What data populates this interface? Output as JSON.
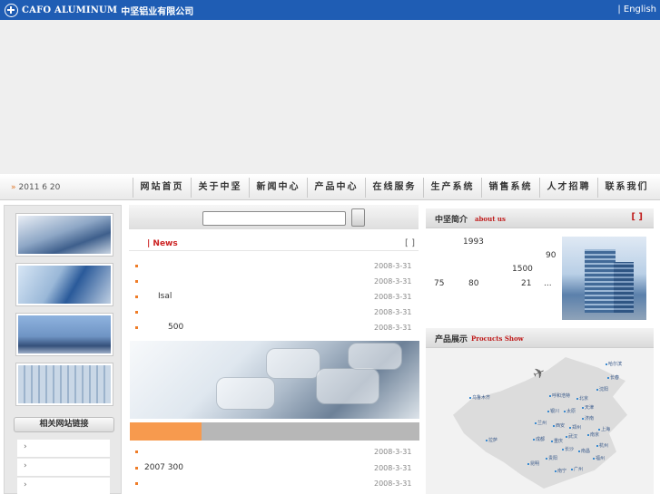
{
  "header": {
    "brand_en": "CAFO ALUMINUM",
    "brand_cn": "中坚铝业有限公司",
    "lang_link": "| English"
  },
  "navbar": {
    "date": "2011 6 20",
    "items": [
      "网站首页",
      "关于中坚",
      "新闻中心",
      "产品中心",
      "在线服务",
      "生产系统",
      "销售系统",
      "人才招聘",
      "联系我们"
    ]
  },
  "left": {
    "thumbs": [
      "building-photo-icon",
      "building-photo-icon",
      "building-photo-icon",
      "building-photo-icon"
    ],
    "links_title": "相关网站链接",
    "links": [
      "›",
      "›",
      "›"
    ]
  },
  "news": {
    "title": "| News",
    "more": "[ ]",
    "items": [
      {
        "text": "",
        "date": "2008-3-31"
      },
      {
        "text": "",
        "date": "2008-3-31"
      },
      {
        "text": "Isal",
        "date": "2008-3-31"
      },
      {
        "text": "",
        "date": "2008-3-31"
      },
      {
        "text": "500",
        "date": "2008-3-31"
      }
    ],
    "lower_items": [
      {
        "text": "",
        "date": "2008-3-31"
      },
      {
        "text": "2007       300",
        "date": "2008-3-31"
      },
      {
        "text": "",
        "date": "2008-3-31"
      }
    ]
  },
  "about": {
    "title_cn": "中坚简介",
    "title_en": "about us",
    "more": "[ ]",
    "texts": [
      "1993",
      "90",
      "1500",
      "75",
      "80",
      "21",
      "..."
    ]
  },
  "products": {
    "title_cn": "产品展示",
    "title_en": "Procucts Show",
    "cities": [
      "哈尔滨",
      "长春",
      "沈阳",
      "北京",
      "呼和浩特",
      "天津",
      "乌鲁木齐",
      "银川",
      "太原",
      "济南",
      "兰州",
      "西安",
      "郑州",
      "上海",
      "南京",
      "成都",
      "重庆",
      "武汉",
      "杭州",
      "长沙",
      "南昌",
      "福州",
      "拉萨",
      "昆明",
      "贵阳",
      "南宁",
      "广州"
    ]
  }
}
